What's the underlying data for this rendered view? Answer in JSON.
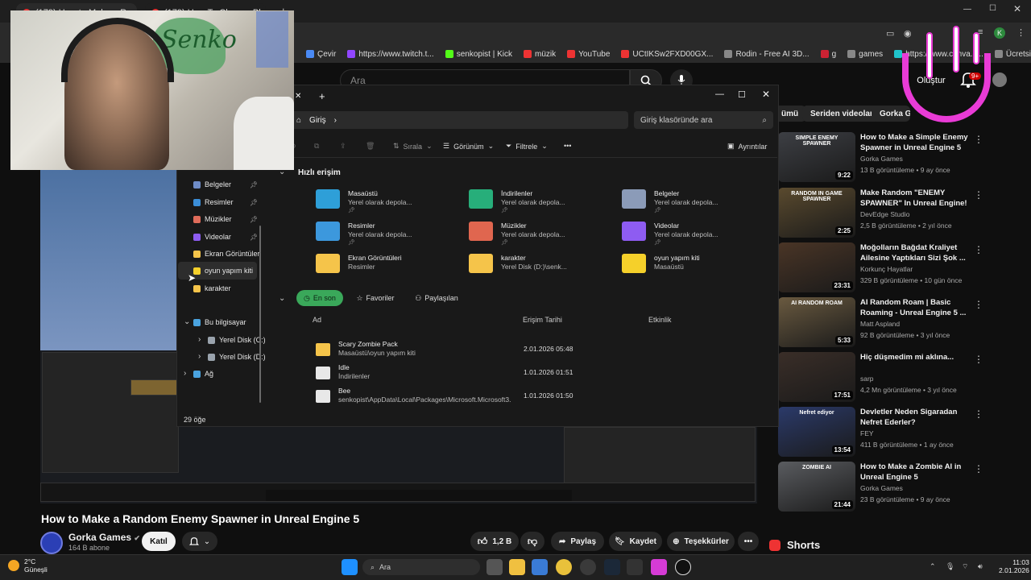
{
  "browser": {
    "tabs": [
      {
        "label": "(179) How to Make a Random"
      },
      {
        "label": "(179) How To Change Player S"
      }
    ],
    "bookmarks": [
      {
        "label": "Çevir",
        "color": "#4a8af4"
      },
      {
        "label": "https://www.twitch.t...",
        "color": "#9146ff"
      },
      {
        "label": "senkopist | Kick",
        "color": "#53fc18"
      },
      {
        "label": "müzik",
        "color": "#e33"
      },
      {
        "label": "YouTube",
        "color": "#e33"
      },
      {
        "label": "UCtIKSw2FXD00GX...",
        "color": "#e33"
      },
      {
        "label": "Rodin - Free AI 3D...",
        "color": "#888"
      },
      {
        "label": "g",
        "color": "#c23"
      },
      {
        "label": "games",
        "color": "#888"
      },
      {
        "label": "https://www.canva.c...",
        "color": "#20c4cb"
      },
      {
        "label": "Ücretsiz PN",
        "color": "#888"
      }
    ],
    "profile_initial": "K"
  },
  "youtube": {
    "search_placeholder": "Ara",
    "create_label": "Oluştur",
    "notif_badge": "9+",
    "chips": [
      "ümü",
      "Seriden videolar",
      "Gorka G"
    ],
    "video_title": "How to Make a Random Enemy Spawner in Unreal Engine 5",
    "channel_name": "Gorka Games",
    "channel_subs": "164 B abone",
    "join_label": "Katıl",
    "like_count": "1,2 B",
    "share_label": "Paylaş",
    "save_label": "Kaydet",
    "thanks_label": "Teşekkürler",
    "shorts_label": "Shorts",
    "recommendations": [
      {
        "title": "How to Make a Simple Enemy Spawner in Unreal Engine 5",
        "channel": "Gorka Games",
        "meta": "13 B görüntüleme • 9 ay önce",
        "duration": "9:22",
        "thumb_text": "SIMPLE ENEMY SPAWNER"
      },
      {
        "title": "Make Random \"ENEMY SPAWNER\" In Unreal Engine!",
        "channel": "DevEdge Studio",
        "meta": "2,5 B görüntüleme • 2 yıl önce",
        "duration": "2:25",
        "thumb_text": "RANDOM IN GAME SPAWNER"
      },
      {
        "title": "Moğolların Bağdat Kraliyet Ailesine Yaptıkları Sizi Şok ...",
        "channel": "Korkunç Hayatlar",
        "meta": "329 B görüntüleme • 10 gün önce",
        "duration": "23:31",
        "thumb_text": ""
      },
      {
        "title": "AI Random Roam | Basic Roaming - Unreal Engine 5 ...",
        "channel": "Matt Aspland",
        "meta": "92 B görüntüleme • 3 yıl önce",
        "duration": "5:33",
        "thumb_text": "AI RANDOM ROAM"
      },
      {
        "title": "Hiç düşmedim mi aklına...",
        "channel": "sarp",
        "meta": "4,2 Mn görüntüleme • 3 yıl önce",
        "duration": "17:51",
        "thumb_text": ""
      },
      {
        "title": "Devletler Neden Sigaradan Nefret Ederler?",
        "channel": "FEY",
        "meta": "411 B görüntüleme • 1 ay önce",
        "duration": "13:54",
        "thumb_text": "Nefret ediyor"
      },
      {
        "title": "How to Make a Zombie AI in Unreal Engine 5",
        "channel": "Gorka Games",
        "meta": "23 B görüntüleme • 9 ay önce",
        "duration": "21:44",
        "thumb_text": "ZOMBIE AI"
      }
    ]
  },
  "explorer": {
    "address_crumb": "Giriş",
    "search_placeholder": "Giriş klasöründe ara",
    "toolbar": {
      "sort": "Sırala",
      "view": "Görünüm",
      "filter": "Filtrele",
      "more": "•••",
      "details": "Ayrıntılar"
    },
    "nav": [
      {
        "label": "Belgeler",
        "pinned": true,
        "color": "#6f8cc7"
      },
      {
        "label": "Resimler",
        "pinned": true,
        "color": "#3b8ed8"
      },
      {
        "label": "Müzikler",
        "pinned": true,
        "color": "#e06c5a"
      },
      {
        "label": "Videolar",
        "pinned": true,
        "color": "#8d5cf0"
      },
      {
        "label": "Ekran Görüntüleri",
        "pinned": false,
        "color": "#f5c44a"
      },
      {
        "label": "oyun yapım kiti",
        "pinned": false,
        "color": "#f5d02a"
      },
      {
        "label": "karakter",
        "pinned": false,
        "color": "#f5c44a"
      },
      {
        "label": "Bu bilgisayar",
        "pinned": false,
        "color": "#4aa3df"
      },
      {
        "label": "Yerel Disk (C:)",
        "pinned": false,
        "color": "#9aa3ad"
      },
      {
        "label": "Yerel Disk (D:)",
        "pinned": false,
        "color": "#9aa3ad"
      },
      {
        "label": "Ağ",
        "pinned": false,
        "color": "#4aa3df"
      }
    ],
    "quick_access_heading": "Hızlı erişim",
    "quick_access": [
      {
        "name": "Masaüstü",
        "sub": "Yerel olarak depola...",
        "pinned": true,
        "color": "#2e9fd8"
      },
      {
        "name": "İndirilenler",
        "sub": "Yerel olarak depola...",
        "pinned": true,
        "color": "#27ae7a"
      },
      {
        "name": "Belgeler",
        "sub": "Yerel olarak depola...",
        "pinned": true,
        "color": "#8b9bb8"
      },
      {
        "name": "Resimler",
        "sub": "Yerel olarak depola...",
        "pinned": true,
        "color": "#3c98dd"
      },
      {
        "name": "Müzikler",
        "sub": "Yerel olarak depola...",
        "pinned": true,
        "color": "#e0664f"
      },
      {
        "name": "Videolar",
        "sub": "Yerel olarak depola...",
        "pinned": true,
        "color": "#8e5cf1"
      },
      {
        "name": "Ekran Görüntüleri",
        "sub": "Resimler",
        "pinned": false,
        "color": "#f5c44a"
      },
      {
        "name": "karakter",
        "sub": "Yerel Disk (D:)\\senk...",
        "pinned": false,
        "color": "#f5c44a"
      },
      {
        "name": "oyun yapım kiti",
        "sub": "Masaüstü",
        "pinned": false,
        "color": "#f5d02a"
      }
    ],
    "filters": {
      "recent": "En son",
      "favorites": "Favoriler",
      "shared": "Paylaşılan"
    },
    "columns": {
      "name": "Ad",
      "date": "Erişim Tarihi",
      "activity": "Etkinlik"
    },
    "files": [
      {
        "name": "Scary Zombie Pack",
        "path": "Masaüstü\\oyun yapım kiti",
        "date": "2.01.2026 05:48",
        "kind": "folder"
      },
      {
        "name": "Idle",
        "path": "İndirilenler",
        "date": "1.01.2026 01:51",
        "kind": "file"
      },
      {
        "name": "Bee",
        "path": "senkopist\\AppData\\Local\\Packages\\Microsoft.Microsoft3...",
        "date": "1.01.2026 01:50",
        "kind": "file"
      }
    ],
    "status": "29 öğe"
  },
  "webcam": {
    "poster_text": "Senko"
  },
  "taskbar": {
    "temp": "2°C",
    "weather": "Güneşli",
    "search": "Ara",
    "time": "11:03",
    "date": "2.01.2026"
  }
}
